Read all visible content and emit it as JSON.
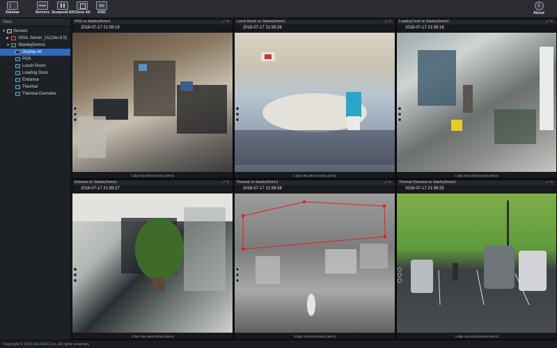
{
  "toolbar": {
    "sidebar_label": "Sidebar",
    "servers_label": "Servers",
    "suspend_all_label": "Suspend All",
    "close_all_label": "Close All",
    "osd_label": "OSD",
    "about_label": "About"
  },
  "sidebar": {
    "header": "Sites",
    "tree": {
      "root": "Servers",
      "server1": "VIGIL Server_211(Ver.9.5)",
      "server2": "StanleyDemo1",
      "items": [
        "Display All",
        "POS",
        "Lunch Room",
        "Loading Dock",
        "Entrance",
        "Thermal",
        "Thermal Overview"
      ]
    }
  },
  "cameras": [
    {
      "title": "POS on StanleyDemo1",
      "timestamp": "2018-07-17 21:59:19",
      "stats": "2.3fps 834.90KB (H264) (MAX)"
    },
    {
      "title": "Lunch Room on StanleyDemo1",
      "timestamp": "2018-07-17 21:59:26",
      "stats": "2.3fps 395.39KB (H264) (MAX)"
    },
    {
      "title": "Loading Dock on StanleyDemo1",
      "timestamp": "2018-07-17 21:59:18",
      "stats": "1.8fps 660.43KB (H264) (MAX)"
    },
    {
      "title": "Entrance on StanleyDemo1",
      "timestamp": "2018-07-17 21:59:27",
      "stats": "1.7fps 786.29KB (H264) (MAX)"
    },
    {
      "title": "Thermal on StanleyDemo1",
      "timestamp": "2018-07-17 21:59:28",
      "stats": "3.0fps 24.67KB (H264) (MAX)"
    },
    {
      "title": "Thermal Overview on StanleyDemo1",
      "timestamp": "2018-07-17 21:59:25",
      "stats": "3.3fps 305.22KB (H264) (MAX)"
    }
  ],
  "footer": {
    "copyright": "Copyright © 2018 3xLOGIC Inc. All rights reserved."
  },
  "colors": {
    "selection": "#2f6ac1",
    "toolbar_bg": "#2a2c31",
    "motion_zone": "#e02020"
  },
  "icons": [
    "sidebar-icon",
    "servers-icon",
    "suspend-icon",
    "close-all-icon",
    "osd-icon",
    "about-icon",
    "server-icon",
    "camera-icon"
  ]
}
